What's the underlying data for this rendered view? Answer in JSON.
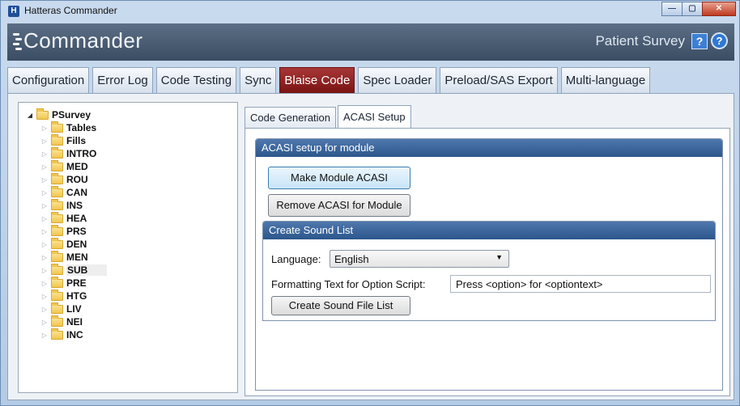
{
  "window": {
    "title": "Hatteras Commander",
    "app_icon_letter": "H",
    "controls": {
      "minimize": "—",
      "maximize": "▢",
      "close": "✕"
    }
  },
  "header": {
    "logo_text": "Commander",
    "module_name": "Patient Survey",
    "help_glyph": "?",
    "about_glyph": "?"
  },
  "main_tabs": [
    {
      "label": "Configuration",
      "active": false
    },
    {
      "label": "Error Log",
      "active": false
    },
    {
      "label": "Code Testing",
      "active": false
    },
    {
      "label": "Sync",
      "active": false
    },
    {
      "label": "Blaise Code",
      "active": true
    },
    {
      "label": "Spec Loader",
      "active": false
    },
    {
      "label": "Preload/SAS Export",
      "active": false
    },
    {
      "label": "Multi-language",
      "active": false
    }
  ],
  "tree": {
    "root": {
      "label": "PSurvey",
      "expanded": true
    },
    "children": [
      {
        "label": "Tables"
      },
      {
        "label": "Fills"
      },
      {
        "label": "INTRO"
      },
      {
        "label": "MED"
      },
      {
        "label": "ROU"
      },
      {
        "label": "CAN"
      },
      {
        "label": "INS"
      },
      {
        "label": "HEA"
      },
      {
        "label": "PRS"
      },
      {
        "label": "DEN"
      },
      {
        "label": "MEN"
      },
      {
        "label": "SUB",
        "selected": true
      },
      {
        "label": "PRE"
      },
      {
        "label": "HTG"
      },
      {
        "label": "LIV"
      },
      {
        "label": "NEI"
      },
      {
        "label": "INC"
      }
    ]
  },
  "sub_tabs": [
    {
      "label": "Code Generation",
      "active": false
    },
    {
      "label": "ACASI Setup",
      "active": true
    }
  ],
  "acasi": {
    "group_title": "ACASI setup for module",
    "make_button": "Make Module ACASI",
    "remove_button": "Remove ACASI for Module"
  },
  "sound_list": {
    "group_title": "Create Sound List",
    "language_label": "Language:",
    "language_value": "English",
    "formatting_label": "Formatting Text for Option Script:",
    "formatting_value": "Press <option> for <optiontext>",
    "create_button": "Create Sound File List"
  }
}
